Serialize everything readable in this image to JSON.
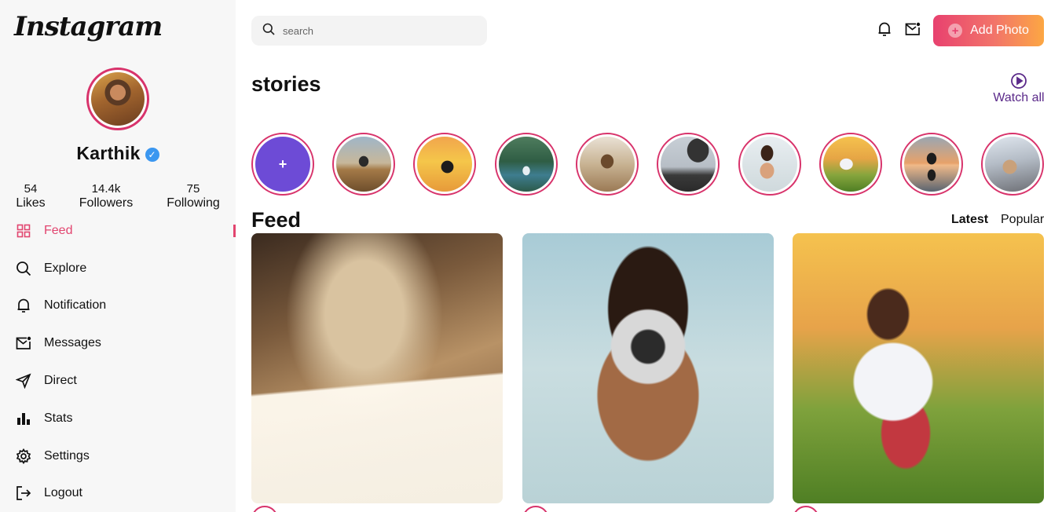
{
  "app": {
    "logo": "Instagram"
  },
  "profile": {
    "name": "Karthik",
    "verified_mark": "✓",
    "stats": [
      {
        "value": "54",
        "label": "Likes"
      },
      {
        "value": "14.4k",
        "label": "Followers"
      },
      {
        "value": "75",
        "label": "Following"
      }
    ]
  },
  "nav": {
    "items": [
      {
        "label": "Feed",
        "icon": "grid-icon",
        "active": true
      },
      {
        "label": "Explore",
        "icon": "search-icon"
      },
      {
        "label": "Notification",
        "icon": "bell-icon"
      },
      {
        "label": "Messages",
        "icon": "mail-icon"
      },
      {
        "label": "Direct",
        "icon": "send-icon"
      },
      {
        "label": "Stats",
        "icon": "bar-chart-icon"
      },
      {
        "label": "Settings",
        "icon": "gear-icon"
      },
      {
        "label": "Logout",
        "icon": "logout-icon"
      }
    ]
  },
  "search": {
    "placeholder": "search"
  },
  "header": {
    "add_photo_label": "Add Photo",
    "add_photo_plus": "+"
  },
  "stories": {
    "title": "stories",
    "watch_all_label": "Watch all",
    "add_story_plus": "+"
  },
  "feed": {
    "title": "Feed",
    "tabs": [
      {
        "label": "Latest",
        "selected": true
      },
      {
        "label": "Popular",
        "selected": false
      }
    ]
  },
  "colors": {
    "accent": "#e2456f",
    "story_ring": "#d8336b",
    "watch_all": "#5b2a8a",
    "verified": "#3b97f0",
    "add_photo_gradient": [
      "#e8416f",
      "#fca743"
    ]
  }
}
